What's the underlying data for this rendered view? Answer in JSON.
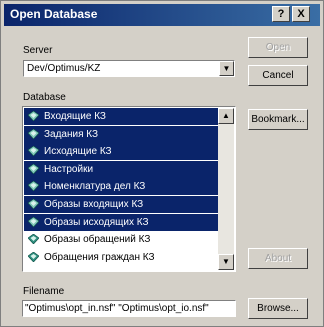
{
  "window": {
    "title": "Open Database",
    "help_label": "?",
    "close_label": "X"
  },
  "server": {
    "label": "Server",
    "value": "Dev/Optimus/KZ"
  },
  "database": {
    "label": "Database",
    "items": [
      {
        "label": "Входящие КЗ",
        "selected": true,
        "icon": "database-icon"
      },
      {
        "label": "Задания КЗ",
        "selected": true,
        "icon": "database-icon"
      },
      {
        "label": "Исходящие КЗ",
        "selected": true,
        "icon": "database-icon"
      },
      {
        "label": "Настройки",
        "selected": true,
        "icon": "database-icon"
      },
      {
        "label": "Номенклатура дел КЗ",
        "selected": true,
        "icon": "database-icon"
      },
      {
        "label": "Образы входящих КЗ",
        "selected": true,
        "icon": "database-icon"
      },
      {
        "label": "Образы исходящих КЗ",
        "selected": true,
        "icon": "database-icon"
      },
      {
        "label": "Образы обращений КЗ",
        "selected": false,
        "icon": "database-icon"
      },
      {
        "label": "Обращения граждан КЗ",
        "selected": false,
        "icon": "database-icon"
      }
    ]
  },
  "filename": {
    "label": "Filename",
    "value": "\"Optimus\\opt_in.nsf\" \"Optimus\\opt_io.nsf\""
  },
  "buttons": {
    "open": "Open",
    "cancel": "Cancel",
    "bookmark": "Bookmark...",
    "about": "About",
    "browse": "Browse..."
  }
}
